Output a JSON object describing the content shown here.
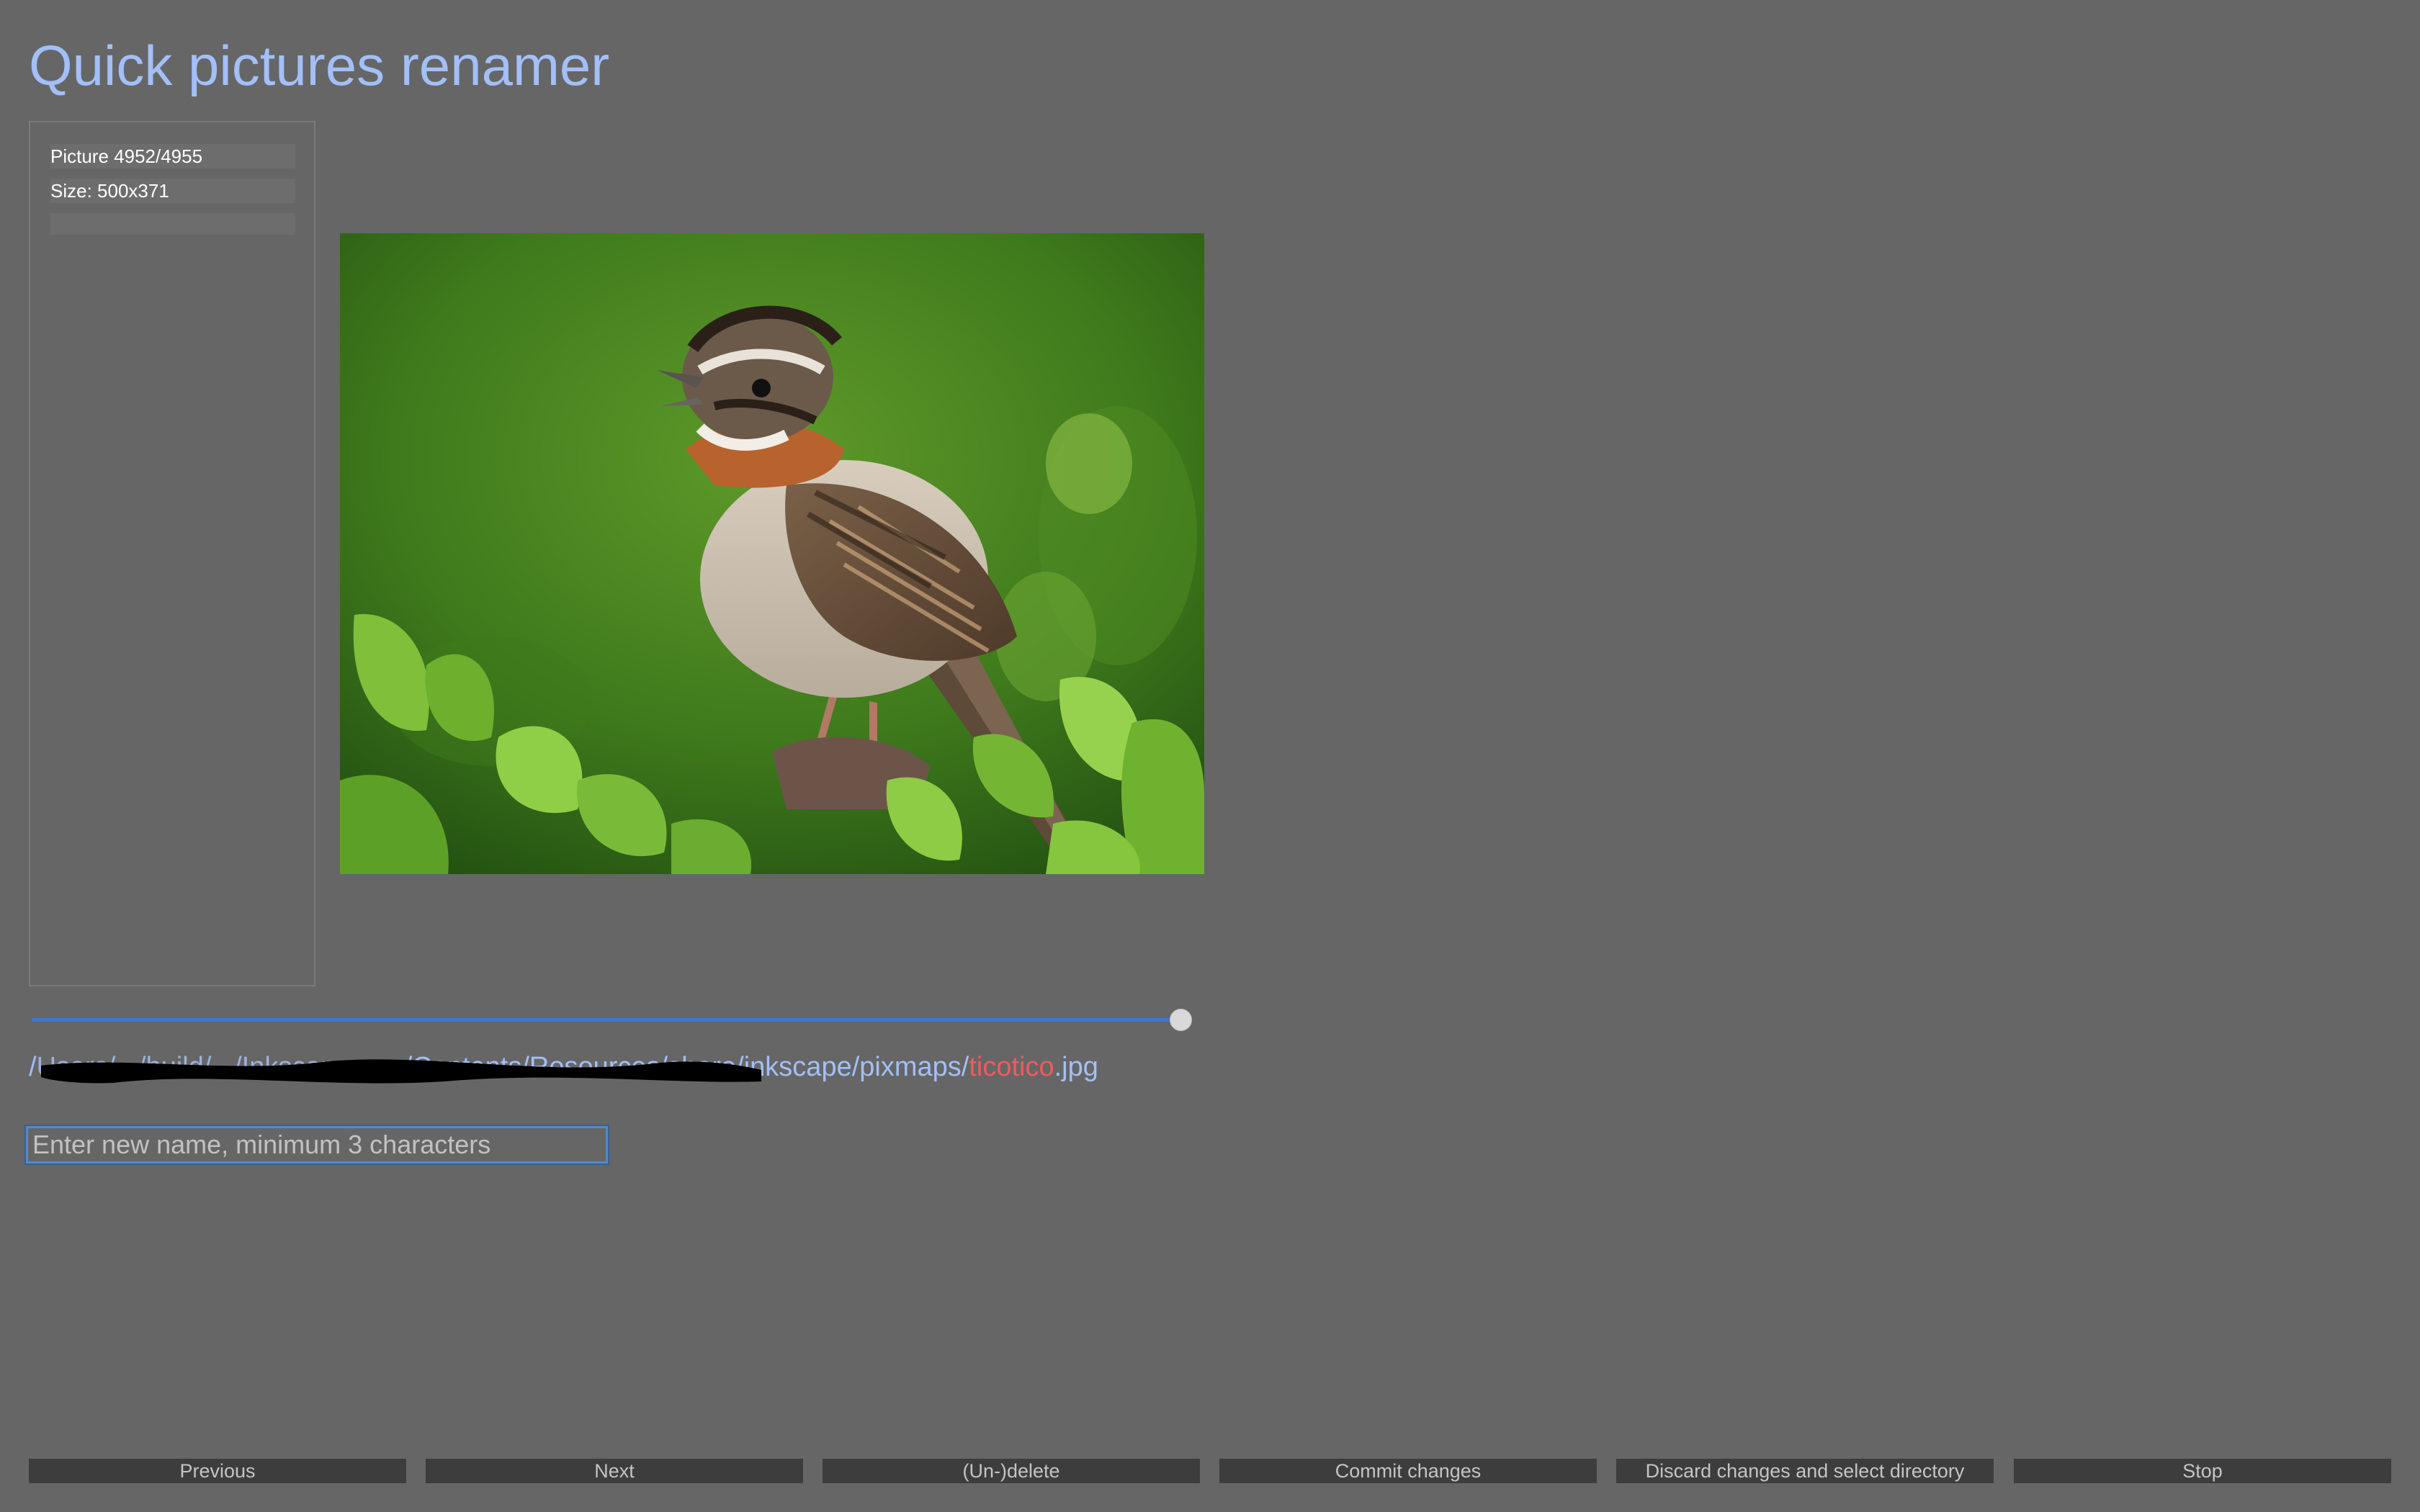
{
  "app": {
    "title": "Quick pictures renamer"
  },
  "info_panel": {
    "picture_counter": "Picture 4952/4955",
    "size": "Size: 500x371",
    "extra": ""
  },
  "navigation": {
    "position_fraction": 0.9994
  },
  "file_path": {
    "start": "/",
    "redacted": "Users/.../build/.../Inkscape.app",
    "visible_dir": "/Contents/Resources/share/inkscape/pixmaps/",
    "name": "ticotico",
    "extension": ".jpg"
  },
  "rename_input": {
    "value": "",
    "placeholder": "Enter new name, minimum 3 characters"
  },
  "buttons": {
    "previous": "Previous",
    "next": "Next",
    "undelete": "(Un-)delete",
    "commit": "Commit changes",
    "discard": "Discard changes and select directory",
    "stop": "Stop"
  },
  "colors": {
    "background": "#666666",
    "title": "#a3bff7",
    "filename_highlight": "#f05b5b",
    "slider_accent": "#3a76d8",
    "button_bg": "#3d3d3d"
  },
  "picture": {
    "subject": "rufous-collared sparrow perched among green leaves"
  }
}
